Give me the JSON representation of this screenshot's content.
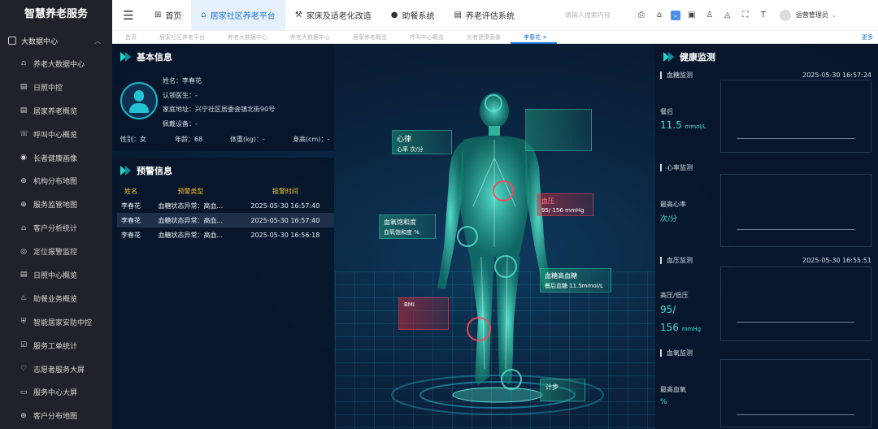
{
  "brand": "智慧养老服务",
  "sidebar": {
    "group_label": "大数据中心",
    "items": [
      {
        "label": "养老大数据中心",
        "icon": "chart-icon"
      },
      {
        "label": "日照中控",
        "icon": "document-icon"
      },
      {
        "label": "居家养老概览",
        "icon": "document-icon"
      },
      {
        "label": "呼叫中心概览",
        "icon": "phone-icon"
      },
      {
        "label": "长者健康画像",
        "icon": "user-icon"
      },
      {
        "label": "机构分布地图",
        "icon": "map-icon"
      },
      {
        "label": "服务监管地图",
        "icon": "map-icon"
      },
      {
        "label": "客户分析统计",
        "icon": "chart-icon"
      },
      {
        "label": "定位报警监控",
        "icon": "location-icon"
      },
      {
        "label": "日照中心概览",
        "icon": "document-icon"
      },
      {
        "label": "助餐业务概览",
        "icon": "meal-icon"
      },
      {
        "label": "智能居家安防中控",
        "icon": "shield-icon"
      },
      {
        "label": "服务工单统计",
        "icon": "checklist-icon"
      },
      {
        "label": "志愿者服务大屏",
        "icon": "heart-icon"
      },
      {
        "label": "服务中心大屏",
        "icon": "screen-icon"
      },
      {
        "label": "客户分布地图",
        "icon": "map-icon"
      }
    ]
  },
  "topbar": {
    "tabs": [
      {
        "label": "首页",
        "icon": "grid-icon",
        "active": false
      },
      {
        "label": "居家社区养老平台",
        "icon": "home-icon",
        "active": true
      },
      {
        "label": "家床及适老化改造",
        "icon": "tool-icon",
        "active": false
      },
      {
        "label": "助餐系统",
        "icon": "bowl-icon",
        "active": false
      },
      {
        "label": "养老评估系统",
        "icon": "doc-icon",
        "active": false
      }
    ],
    "search_placeholder": "请输入搜索内容",
    "user_name": "运营管理员"
  },
  "tabbar": {
    "tabs": [
      "首页",
      "居家社区养老平台",
      "养老大数据中心",
      "养老大数据中心",
      "居家养老概览",
      "呼叫中心概览",
      "长者健康画像",
      "李春花"
    ],
    "active_tab": "李春花",
    "more": "更多"
  },
  "basic_info": {
    "title": "基本信息",
    "name": "姓名：李春花",
    "doctor": "认领医生：-",
    "address": "家庭地址：兴宁社区居委会镇北街90号",
    "device": "佩戴设备：-",
    "gender": "性别：女",
    "age": "年龄：68",
    "weight": "体重(kg)：-",
    "height": "身高(cm)：-"
  },
  "warning_info": {
    "title": "预警信息",
    "columns": [
      "姓名",
      "预警类型",
      "报警时间"
    ],
    "rows": [
      [
        "李春花",
        "血糖状态异常：高血...",
        "2025-05-30 16:57:40"
      ],
      [
        "李春花",
        "血糖状态异常：高血...",
        "2025-05-30 16:57:40"
      ],
      [
        "李春花",
        "血糖状态异常：高血...",
        "2025-05-30 16:56:18"
      ]
    ],
    "selected_row": 1
  },
  "body_callouts": {
    "heart_rate_title": "心律",
    "heart_rate_value": "心率  次/分",
    "blood_pressure_title": "血压",
    "blood_pressure_value": "95/ 156 mmHg",
    "spo2_title": "血氧饱和度",
    "spo2_value": "血氧饱和度  %",
    "glucose_title": "血糖高血糖",
    "glucose_value": "餐后血糖  11.5mmol/L",
    "bmi_title": "BMI",
    "steps_title": "计步"
  },
  "health": {
    "title": "健康监测",
    "sections": [
      {
        "title": "血糖监测",
        "time": "2025-05-30 16:57:24",
        "label": "餐后",
        "value": "11.5",
        "unit": "mmol/L"
      },
      {
        "title": "心率监测",
        "time": "",
        "label": "最高心率",
        "value": "次/分",
        "unit": ""
      },
      {
        "title": "血压监测",
        "time": "2025-05-30 16:55:51",
        "label": "高压/低压",
        "value": "95/",
        "value2": "156",
        "unit": "mmHg"
      },
      {
        "title": "血氧监测",
        "time": "",
        "label": "最高血氧",
        "value": "%",
        "unit": ""
      }
    ]
  },
  "colors": {
    "accent_teal": "#1fd8c8",
    "warning_yellow": "#f0c02a",
    "active_blue": "#1e73d6",
    "sidebar_bg": "#1f2329"
  }
}
